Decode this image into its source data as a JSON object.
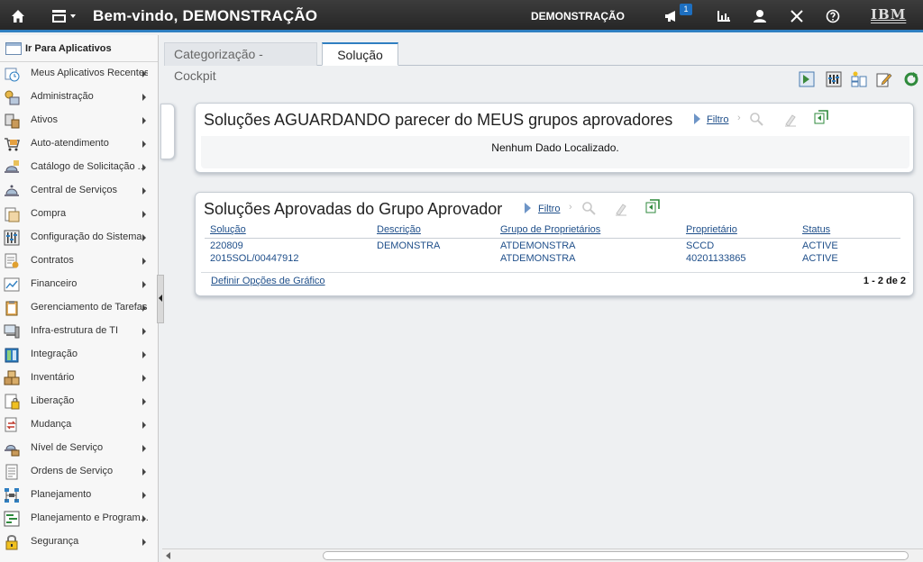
{
  "header": {
    "title": "Bem-vindo, DEMONSTRAÇÃO",
    "user": "DEMONSTRAÇÃO",
    "notification_count": "1",
    "logo": "IBM"
  },
  "sidebar": {
    "title": "Ir Para Aplicativos",
    "items": [
      {
        "label": "Meus Aplicativos Recentes",
        "icon": "clock-icon"
      },
      {
        "label": "Administração",
        "icon": "admin-icon"
      },
      {
        "label": "Ativos",
        "icon": "assets-icon"
      },
      {
        "label": "Auto-atendimento",
        "icon": "cart-icon"
      },
      {
        "label": "Catálogo de Solicitação ...",
        "icon": "bell-catalog-icon"
      },
      {
        "label": "Central de Serviços",
        "icon": "bell-service-icon"
      },
      {
        "label": "Compra",
        "icon": "purchase-icon"
      },
      {
        "label": "Configuração do Sistema",
        "icon": "sliders-icon"
      },
      {
        "label": "Contratos",
        "icon": "contract-icon"
      },
      {
        "label": "Financeiro",
        "icon": "chart-icon"
      },
      {
        "label": "Gerenciamento de Tarefas",
        "icon": "clipboard-icon"
      },
      {
        "label": "Infra-estrutura de TI",
        "icon": "computer-icon"
      },
      {
        "label": "Integração",
        "icon": "integration-icon"
      },
      {
        "label": "Inventário",
        "icon": "boxes-icon"
      },
      {
        "label": "Liberação",
        "icon": "release-icon"
      },
      {
        "label": "Mudança",
        "icon": "change-icon"
      },
      {
        "label": "Nível de Serviço",
        "icon": "service-level-icon"
      },
      {
        "label": "Ordens de Serviço",
        "icon": "work-order-icon"
      },
      {
        "label": "Planejamento",
        "icon": "planning-icon"
      },
      {
        "label": "Planejamento e Program...",
        "icon": "schedule-icon"
      },
      {
        "label": "Segurança",
        "icon": "lock-icon"
      }
    ]
  },
  "tabs": [
    {
      "label": "Categorização - Cockpit"
    },
    {
      "label": "Solução"
    }
  ],
  "panel1": {
    "title": "Soluções AGUARDANDO parecer do MEUS grupos aprovadores",
    "filter_label": "Filtro",
    "empty_message": "Nenhum Dado Localizado."
  },
  "panel2": {
    "title": "Soluções Aprovadas do Grupo Aprovador",
    "filter_label": "Filtro",
    "columns": [
      "Solução",
      "Descrição",
      "Grupo de Proprietários",
      "Proprietário",
      "Status"
    ],
    "rows": [
      [
        "220809",
        "DEMONSTRA",
        "ATDEMONSTRA",
        "SCCD",
        "ACTIVE"
      ],
      [
        "2015SOL/00447912",
        "",
        "ATDEMONSTRA",
        "40201133865",
        "ACTIVE"
      ]
    ],
    "chart_link": "Definir Opções de Gráfico",
    "pager": "1 - 2 de 2"
  },
  "colors": {
    "accent": "#2f7fc1",
    "link": "#1f4f8a",
    "header_bg": "#2e2e2e"
  }
}
